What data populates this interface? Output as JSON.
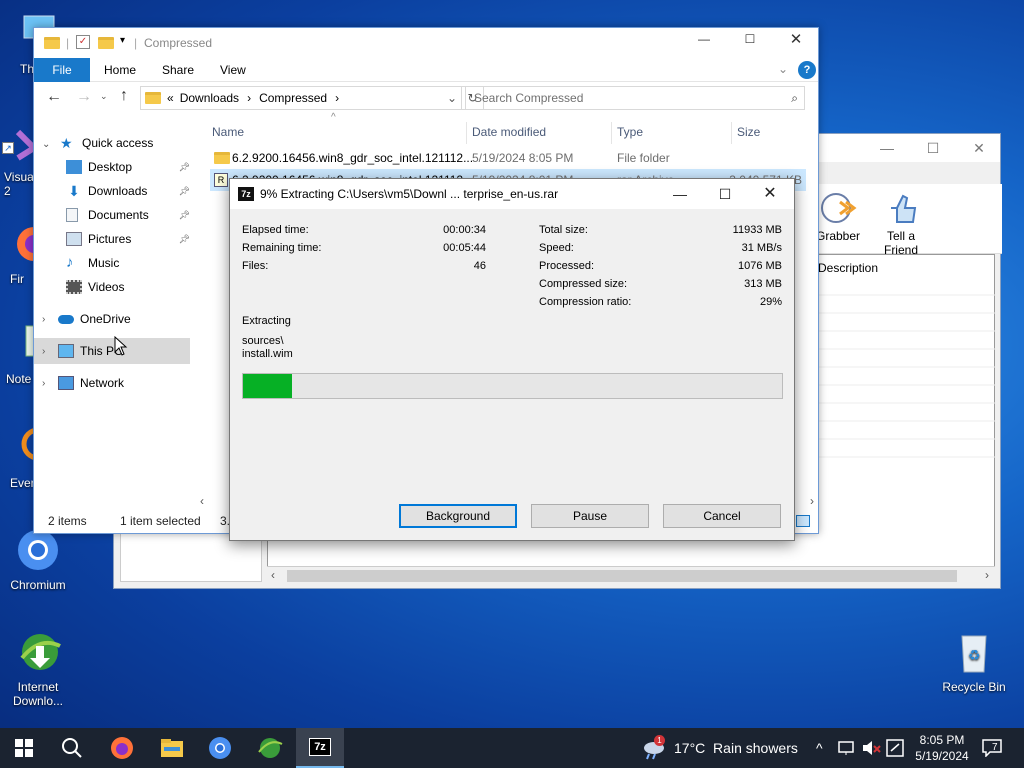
{
  "desktop": {
    "icons": [
      {
        "label": "Thi",
        "name": "this-pc"
      },
      {
        "label": "Visual\n2",
        "name": "visual-studio"
      },
      {
        "label": "Fir",
        "name": "firefox"
      },
      {
        "label": "Note",
        "name": "notepad"
      },
      {
        "label": "Ever",
        "name": "everything"
      },
      {
        "label": "Chromium",
        "name": "chromium"
      },
      {
        "label": "Internet\nDownlo...",
        "name": "internet-download-manager"
      },
      {
        "label": "Recycle Bin",
        "name": "recycle-bin"
      }
    ]
  },
  "idm": {
    "toolbar": {
      "grabber": "Grabber",
      "tell_friend": "Tell a Friend"
    },
    "list_header": {
      "description": "Description"
    }
  },
  "explorer": {
    "title": "Compressed",
    "ribbon_tabs": [
      "File",
      "Home",
      "Share",
      "View"
    ],
    "address": {
      "prefix": "«",
      "crumb1": "Downloads",
      "crumb2": "Compressed"
    },
    "search_placeholder": "Search Compressed",
    "nav": {
      "quick_access": "Quick access",
      "items": [
        "Desktop",
        "Downloads",
        "Documents",
        "Pictures",
        "Music",
        "Videos"
      ],
      "onedrive": "OneDrive",
      "this_pc": "This PC",
      "network": "Network"
    },
    "columns": {
      "name": "Name",
      "date": "Date modified",
      "type": "Type",
      "size": "Size"
    },
    "files": [
      {
        "name": "6.2.9200.16456.win8_gdr_soc_intel.121112...",
        "date": "5/19/2024 8:05 PM",
        "type": "File folder",
        "size": ""
      },
      {
        "name": "6.2.9200.16456.win8_gdr_soc_intel.121112...",
        "date": "5/19/2024 8:01 PM",
        "type": "rar Archive",
        "size": "3,040,571 KB"
      }
    ],
    "status": {
      "count": "2 items",
      "selected": "1 item selected",
      "size": "3.76 GB"
    }
  },
  "dialog": {
    "title": "9% Extracting C:\\Users\\vm5\\Downl ... terprise_en-us.rar",
    "icon_text": "7z",
    "elapsed_label": "Elapsed time:",
    "elapsed": "00:00:34",
    "remaining_label": "Remaining time:",
    "remaining": "00:05:44",
    "files_label": "Files:",
    "files": "46",
    "total_label": "Total size:",
    "total": "11933 MB",
    "speed_label": "Speed:",
    "speed": "31 MB/s",
    "processed_label": "Processed:",
    "processed": "1076 MB",
    "compressed_label": "Compressed size:",
    "compressed": "313 MB",
    "ratio_label": "Compression ratio:",
    "ratio": "29%",
    "status": "Extracting",
    "path1": "sources\\",
    "path2": "install.wim",
    "progress": 0.09,
    "buttons": {
      "background": "Background",
      "pause": "Pause",
      "cancel": "Cancel"
    }
  },
  "taskbar": {
    "weather": "17°C  Rain showers",
    "time": "8:05 PM",
    "date": "5/19/2024",
    "notification_count": "7",
    "weather_badge": "1"
  },
  "colors": {
    "accent": "#0078d7",
    "progress": "#06b025",
    "taskbar": "#1b2330"
  }
}
